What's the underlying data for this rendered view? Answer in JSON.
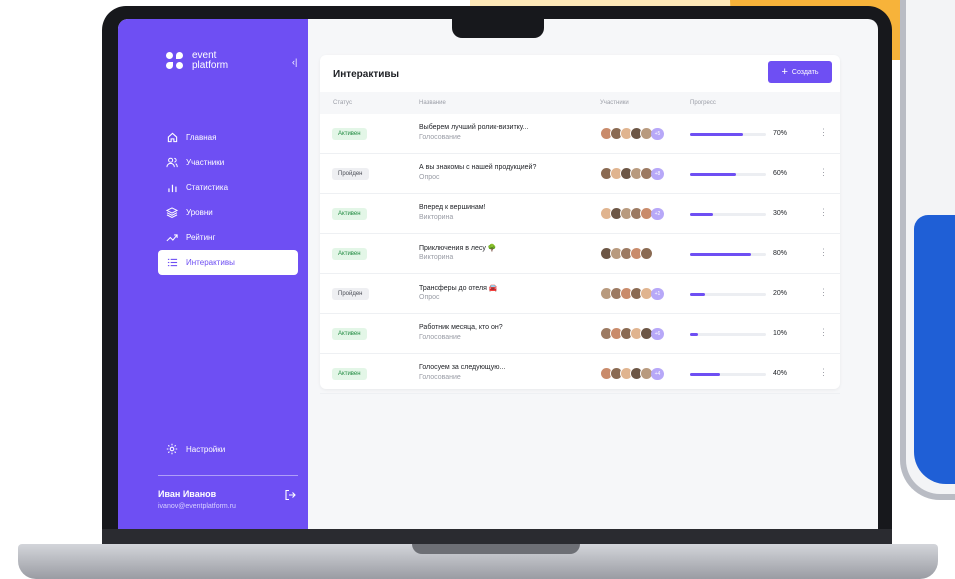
{
  "colors": {
    "accent": "#6e4ff3",
    "active_badge": "#1f8a3f",
    "done_badge": "#4a4d55"
  },
  "sidebar": {
    "logo_line1": "event",
    "logo_line2": "platform",
    "items": [
      {
        "label": "Главная",
        "icon": "home-icon"
      },
      {
        "label": "Участники",
        "icon": "users-icon"
      },
      {
        "label": "Статистика",
        "icon": "stats-icon"
      },
      {
        "label": "Уровни",
        "icon": "layers-icon"
      },
      {
        "label": "Рейтинг",
        "icon": "trend-icon"
      },
      {
        "label": "Интерактивы",
        "icon": "list-icon",
        "active": true
      }
    ],
    "settings": "Настройки",
    "user_name": "Иван Иванов",
    "user_email": "ivanov@eventplatform.ru"
  },
  "card": {
    "title": "Интерактивы",
    "create_label": "Создать",
    "headers": {
      "status": "Статус",
      "name": "Название",
      "participants": "Участники",
      "progress": "Прогресс"
    },
    "rows": [
      {
        "status": "Активен",
        "state": "active",
        "name": "Выберем лучший ролик-визитку...",
        "type": "Голосование",
        "extra": "+5",
        "progress": 70,
        "progress_label": "70%"
      },
      {
        "status": "Пройден",
        "state": "done",
        "name": "А вы знакомы с нашей продукцией?",
        "type": "Опрос",
        "extra": "+8",
        "progress": 60,
        "progress_label": "60%"
      },
      {
        "status": "Активен",
        "state": "active",
        "name": "Вперед к вершинам!",
        "type": "Викторина",
        "extra": "+2",
        "progress": 30,
        "progress_label": "30%"
      },
      {
        "status": "Активен",
        "state": "active",
        "name": "Приключения в лесу 🌳",
        "type": "Викторина",
        "extra": "",
        "progress": 80,
        "progress_label": "80%"
      },
      {
        "status": "Пройден",
        "state": "done",
        "name": "Трансферы до отеля 🚘",
        "type": "Опрос",
        "extra": "+1",
        "progress": 20,
        "progress_label": "20%"
      },
      {
        "status": "Активен",
        "state": "active",
        "name": "Работник месяца, кто он?",
        "type": "Голосование",
        "extra": "+6",
        "progress": 10,
        "progress_label": "10%"
      },
      {
        "status": "Активен",
        "state": "active",
        "name": "Голосуем за следующую...",
        "type": "Голосование",
        "extra": "+4",
        "progress": 40,
        "progress_label": "40%"
      }
    ]
  }
}
